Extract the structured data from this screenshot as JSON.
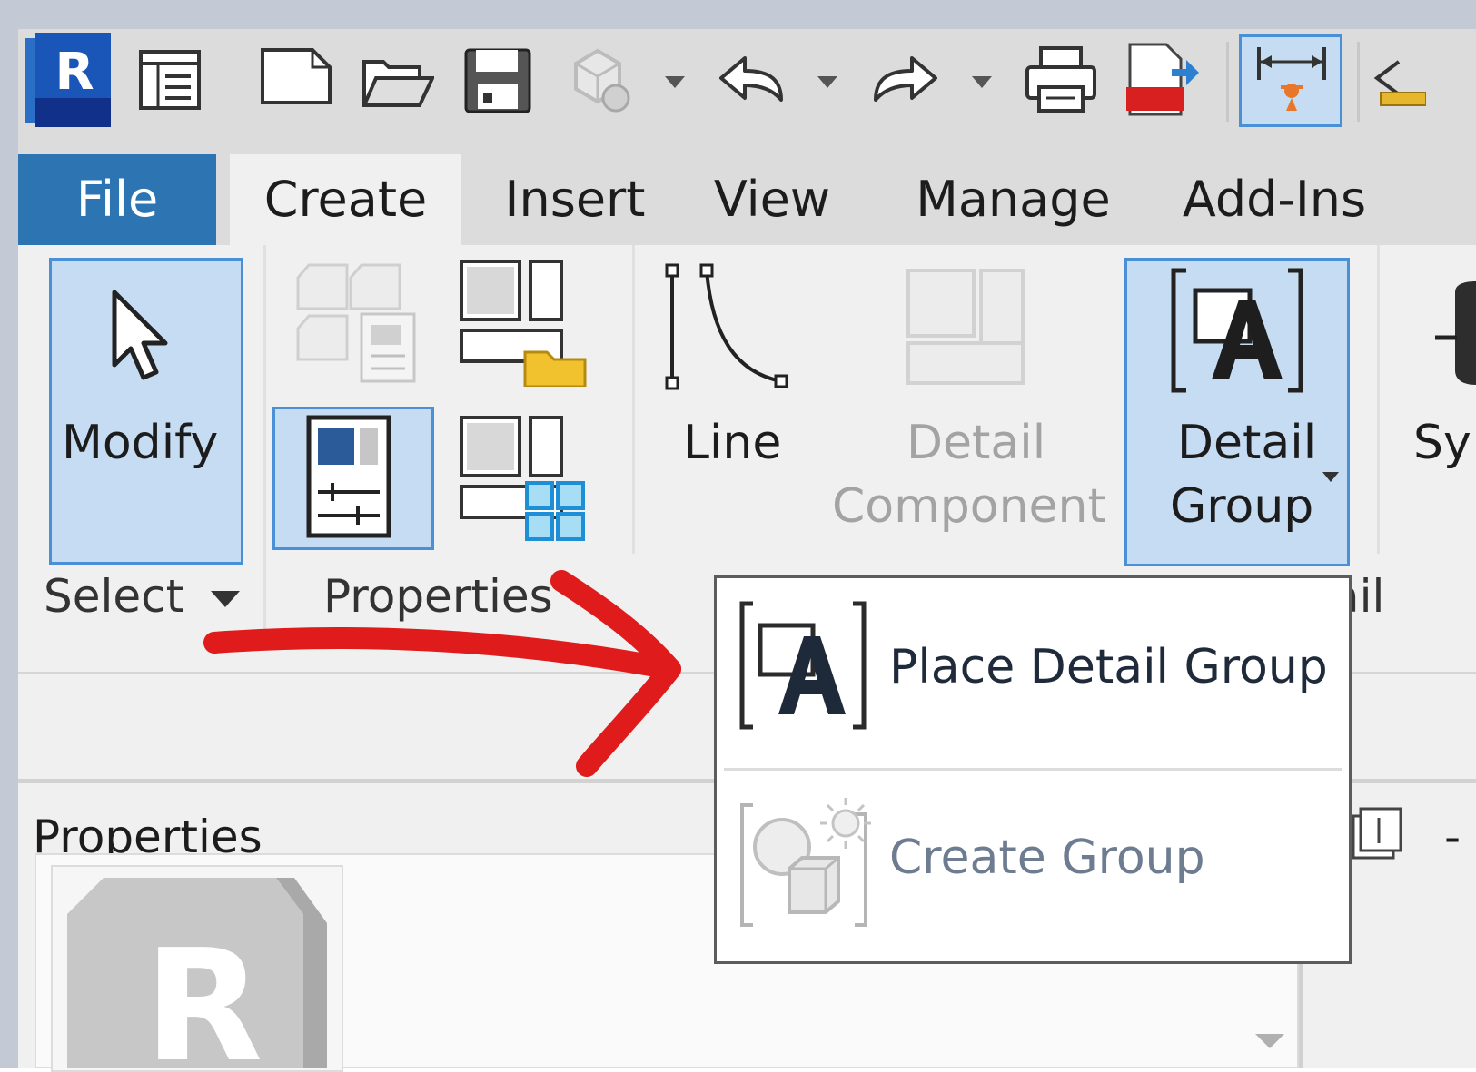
{
  "ribbon_tabs": [
    "File",
    "Create",
    "Insert",
    "View",
    "Manage",
    "Add-Ins"
  ],
  "ribbon": {
    "modify_label": "Modify",
    "line_label": "Line",
    "detail_component_line1": "Detail",
    "detail_component_line2": "Component",
    "detail_group_line1": "Detail",
    "detail_group_line2": "Group",
    "symbol_partial": "Sy",
    "panels": {
      "select": "Select",
      "properties": "Properties",
      "detail_partial": "ail"
    }
  },
  "dropdown_menu": {
    "items": [
      {
        "label": "Place Detail Group",
        "enabled": true
      },
      {
        "label": "Create Group",
        "enabled": false
      }
    ]
  },
  "properties_panel": {
    "title": "Properties",
    "dash": "-"
  },
  "app_logo_letter": "R",
  "colors": {
    "file_tab": "#2d74b3",
    "selection_fill": "#c5dcf2",
    "selection_border": "#4a90d6",
    "annotation_arrow": "#e01b1b"
  }
}
